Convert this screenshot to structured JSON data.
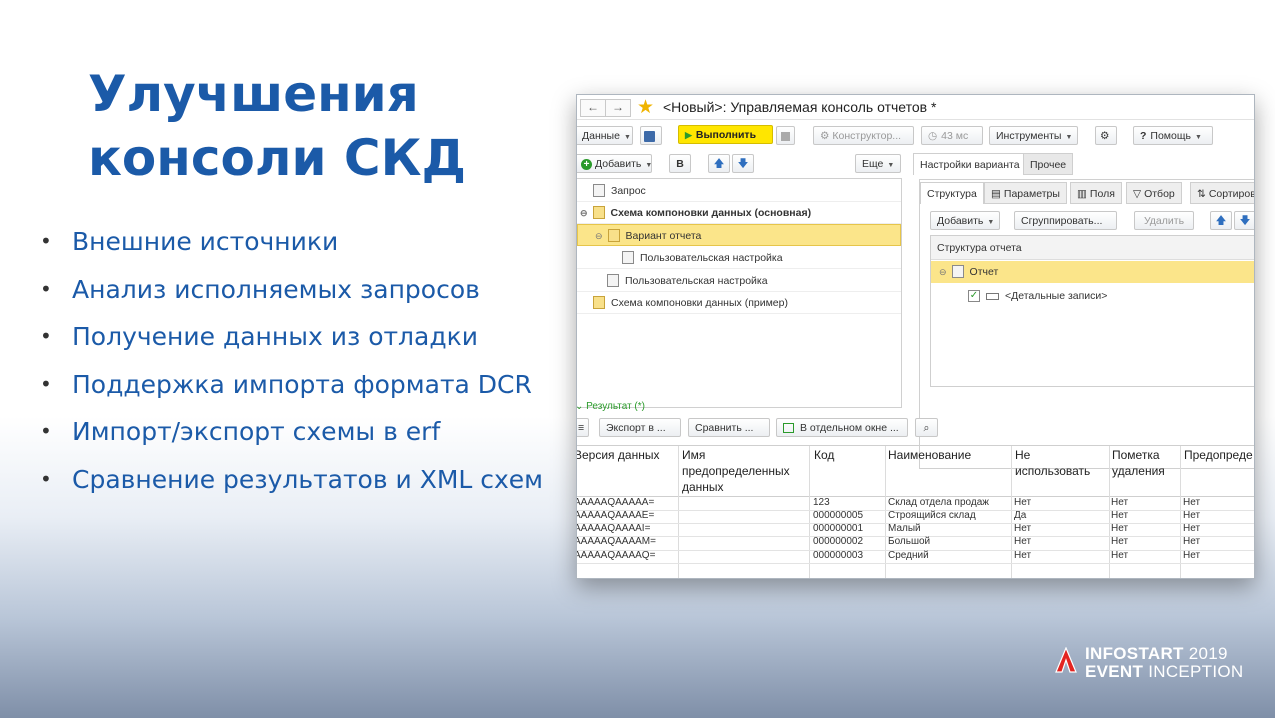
{
  "slide": {
    "title_line1": "Улучшения",
    "title_line2": "консоли СКД",
    "bullets": [
      "Внешние источники",
      "Анализ исполняемых запросов",
      "Получение данных из отладки",
      "Поддержка импорта формата DCR",
      "Импорт/экспорт схемы в erf",
      "Сравнение результатов и XML схем"
    ],
    "bullet_symbol": "•"
  },
  "window": {
    "back": "←",
    "forward": "→",
    "star": "★",
    "title": "<Новый>: Управляемая консоль отчетов *",
    "toolbar": {
      "data": "Данные",
      "run": "Выполнить",
      "constructor": "Конструктор...",
      "time": "43 мс",
      "tools": "Инструменты",
      "help": "Помощь"
    },
    "left": {
      "add": "Добавить",
      "b": "В",
      "more": "Еще",
      "tree": [
        "Запрос",
        "Схема компоновки данных (основная)",
        "Вариант отчета",
        "Пользовательская настройка",
        "Пользовательская настройка",
        "Схема компоновки данных (пример)"
      ]
    },
    "right": {
      "tab1": "Настройки варианта",
      "tab2": "Прочее",
      "subtabs": [
        "Структура",
        "Параметры",
        "Поля",
        "Отбор",
        "Сортиров"
      ],
      "add": "Добавить",
      "group": "Сгруппировать...",
      "delete": "Удалить",
      "structure_header": "Структура отчета",
      "report": "Отчет",
      "detail": "<Детальные записи>"
    },
    "result": {
      "label": "Результат (*)",
      "export": "Экспорт в ...",
      "compare": "Сравнить ...",
      "separate": "В отдельном окне ...",
      "columns": [
        "Версия данных",
        "Имя предопределенных данных",
        "Код",
        "Наименование",
        "Не использовать",
        "Пометка удаления",
        "Предопреде"
      ],
      "rows": [
        [
          "AAAAAQAAAAA=",
          "",
          "123",
          "Склад отдела продаж",
          "Нет",
          "Нет",
          "Нет"
        ],
        [
          "AAAAAQAAAAE=",
          "",
          "000000005",
          "Строящийся склад",
          "Да",
          "Нет",
          "Нет"
        ],
        [
          "AAAAAQAAAAI=",
          "",
          "000000001",
          "Малый",
          "Нет",
          "Нет",
          "Нет"
        ],
        [
          "AAAAAQAAAAM=",
          "",
          "000000002",
          "Большой",
          "Нет",
          "Нет",
          "Нет"
        ],
        [
          "AAAAAQAAAAQ=",
          "",
          "000000003",
          "Средний",
          "Нет",
          "Нет",
          "Нет"
        ]
      ]
    }
  },
  "logo": {
    "line1": "INFOSTART",
    "year": "2019",
    "line2": "EVENT",
    "line2b": "INCEPTION"
  }
}
